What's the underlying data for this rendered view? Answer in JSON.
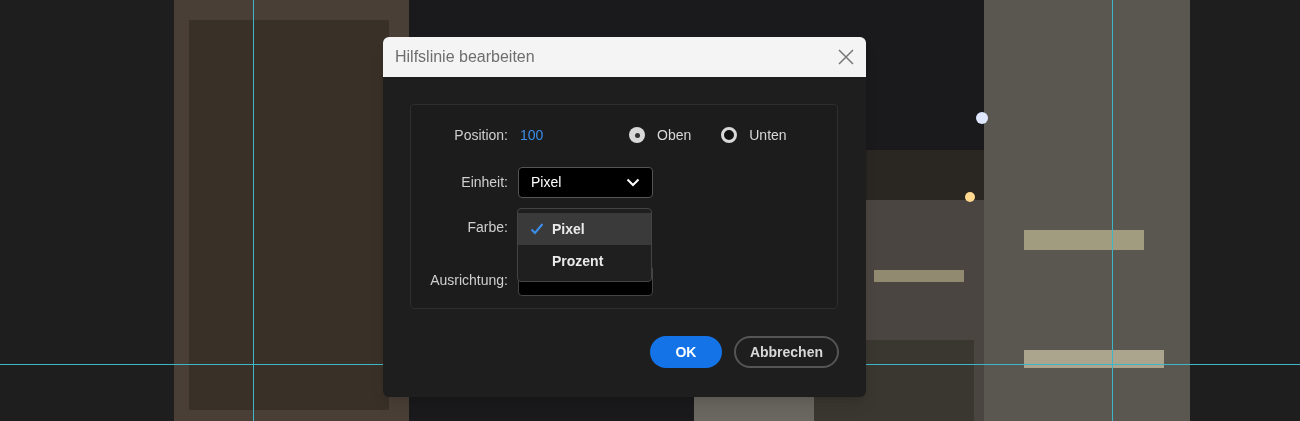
{
  "dialog": {
    "title": "Hilfslinie bearbeiten",
    "position": {
      "label": "Position:",
      "value": "100"
    },
    "placement_options": [
      {
        "label": "Oben",
        "selected": true
      },
      {
        "label": "Unten",
        "selected": false
      }
    ],
    "unit": {
      "label": "Einheit:",
      "value": "Pixel"
    },
    "color": {
      "label": "Farbe:"
    },
    "orientation": {
      "label": "Ausrichtung:"
    },
    "unit_menu": [
      {
        "label": "Pixel",
        "selected": true
      },
      {
        "label": "Prozent",
        "selected": false
      }
    ],
    "buttons": [
      {
        "label": "OK",
        "kind": "primary"
      },
      {
        "label": "Abbrechen",
        "kind": "secondary"
      }
    ]
  }
}
